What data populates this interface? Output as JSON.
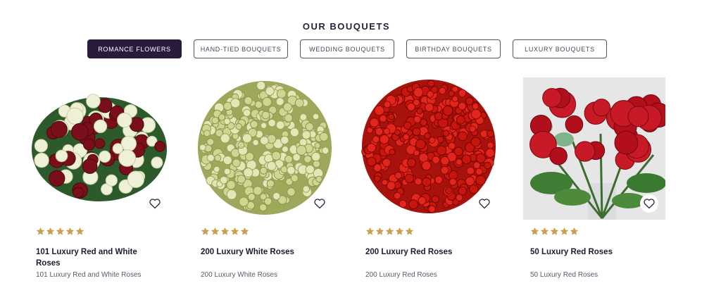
{
  "section": {
    "title": "OUR BOUQUETS"
  },
  "tabs": [
    {
      "label": "ROMANCE FLOWERS",
      "active": true
    },
    {
      "label": "HAND-TIED BOUQUETS",
      "active": false
    },
    {
      "label": "WEDDING BOUQUETS",
      "active": false
    },
    {
      "label": "BIRTHDAY BOUQUETS",
      "active": false
    },
    {
      "label": "LUXURY BOUQUETS",
      "active": false
    }
  ],
  "products": [
    {
      "name": "101 Luxury Red and White Roses",
      "description": "101 Luxury Red and White Roses",
      "rating": 5,
      "image": "red-and-white-roses-bouquet"
    },
    {
      "name": "200 Luxury White Roses",
      "description": "200 Luxury White Roses",
      "rating": 5,
      "image": "white-roses-bouquet"
    },
    {
      "name": "200 Luxury Red Roses",
      "description": "200 Luxury Red Roses",
      "rating": 5,
      "image": "red-roses-bouquet"
    },
    {
      "name": "50 Luxury Red Roses",
      "description": "50 Luxury Red Roses",
      "rating": 5,
      "image": "red-roses-vase"
    }
  ],
  "colors": {
    "accent": "#2a1b3d",
    "star": "#c8a04e",
    "text": "#22182f"
  }
}
